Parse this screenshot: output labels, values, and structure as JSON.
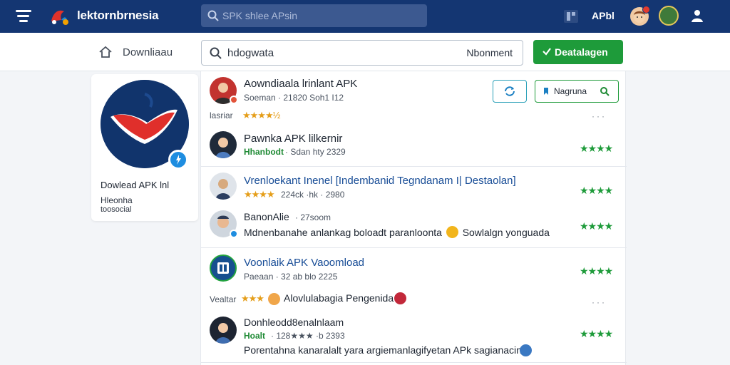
{
  "header": {
    "brand": "lektornbrnesia",
    "search_placeholder": "SPK shlee APsin",
    "label": "APbl"
  },
  "subbar": {
    "breadcrumb": "Downliaau",
    "search_query": "hdogwata",
    "search_right": "Nbonment",
    "action_button": "Deatalagen"
  },
  "app_card": {
    "title": "Dowlead APK lnl",
    "subtitle_1": "Hleonha",
    "subtitle_2": "toosocial"
  },
  "list": {
    "row1": {
      "title": "Aowndiaala lrinlant APK",
      "meta": "Soeman · 21820 Soh1 I12",
      "rating_label": "lasriar",
      "stars": "★★★★½",
      "refresh_icon": "refresh-icon",
      "button_label": "Nagruna"
    },
    "row2": {
      "title": "Pawnka APK lilkernir",
      "meta_tag": "Hhanbodt",
      "meta": "· Sdan hty 2329",
      "stars": "★★★★"
    },
    "row3": {
      "title": "Vrenloekant Inenel [Indembanid Tegndanam I| Destaolan]",
      "stars_meta": "★★★★",
      "meta": "224ck ·hk · 2980",
      "stars": "★★★★"
    },
    "row4": {
      "title": "BanonAlie",
      "meta": "· 27soom",
      "desc_a": "Mdnenbanahe anlankag boloadt paranloonta",
      "desc_b": "Sowlalgn yonguada",
      "stars": "★★★★"
    },
    "row5": {
      "title": "Voonlaik APK Vaoomload",
      "meta": "Paeaan · 32 ab blo 2225",
      "rating_label": "Vealtar",
      "stars_gold": "★★★",
      "desc": "Alovlulabagia Pengenida",
      "stars": "★★★★"
    },
    "row6": {
      "title": "Donhleodd8enalnlaam",
      "meta_tag": "Hoalt",
      "meta": "· 128★★★ ·b 2393",
      "desc": "Porentahna kanaralalt yara argiemanlagifyetan APk sagianacin",
      "stars": "★★★★"
    }
  },
  "colors": {
    "nav": "#143672",
    "accent_green": "#1e9b3a",
    "link_blue": "#174c96",
    "star_gold": "#e59e1a"
  }
}
